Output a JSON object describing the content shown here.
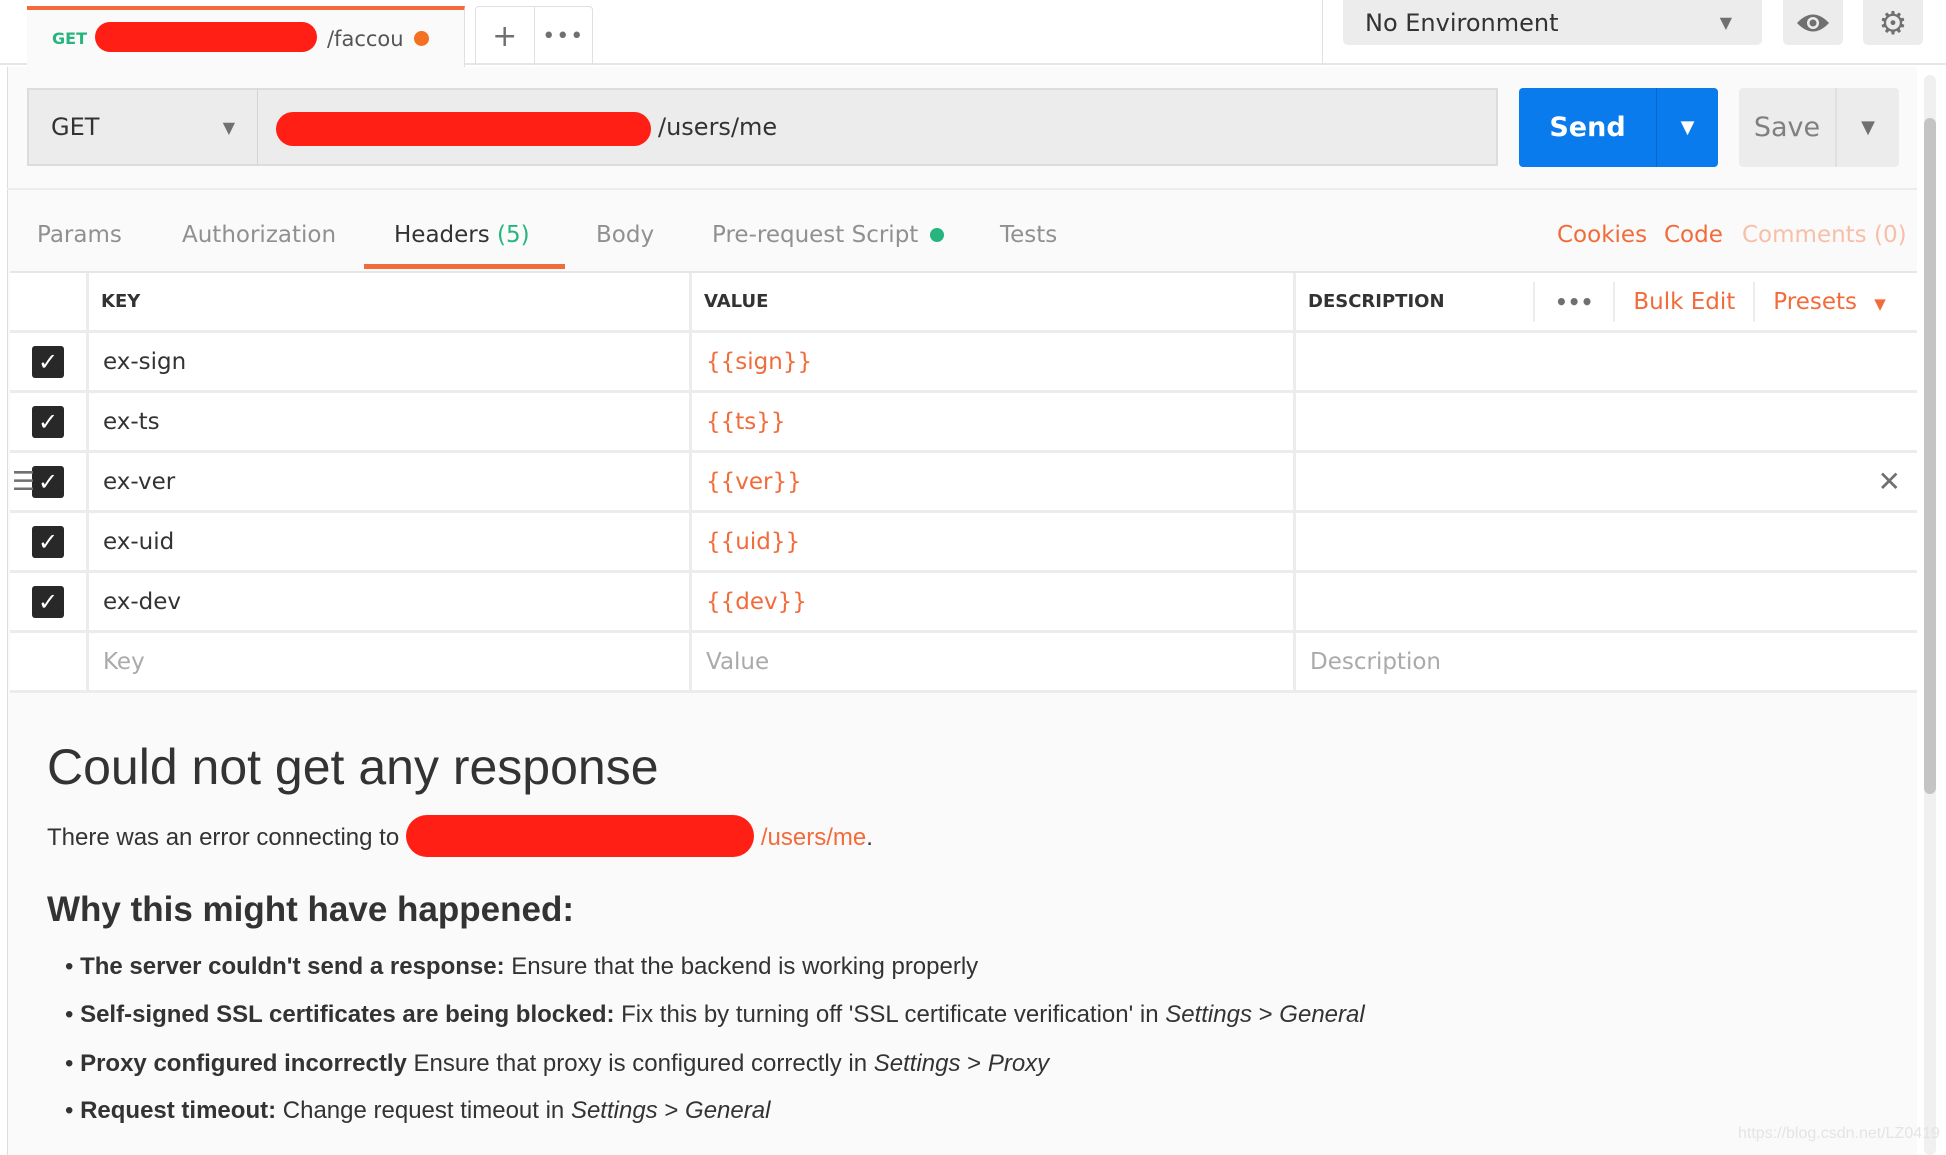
{
  "tab": {
    "method": "GET",
    "title_fragment": "/faccou",
    "unsaved_color": "#f47023"
  },
  "tab_actions": {
    "new": "+",
    "more": "•••"
  },
  "environment": {
    "selected": "No Environment"
  },
  "request": {
    "method": "GET",
    "url_fragment": "/users/me"
  },
  "buttons": {
    "send": "Send",
    "save": "Save"
  },
  "request_tabs": [
    {
      "label": "Params"
    },
    {
      "label": "Authorization"
    },
    {
      "label": "Headers",
      "count": "(5)",
      "active": true
    },
    {
      "label": "Body"
    },
    {
      "label": "Pre-request Script",
      "indicator_color": "#26b47f"
    },
    {
      "label": "Tests"
    }
  ],
  "links": {
    "cookies": "Cookies",
    "code": "Code",
    "comments": "Comments (0)"
  },
  "headers_table": {
    "columns": {
      "key": "KEY",
      "value": "VALUE",
      "description": "DESCRIPTION"
    },
    "more": "•••",
    "bulk_edit": "Bulk Edit",
    "presets": "Presets",
    "rows": [
      {
        "key": "ex-sign",
        "value": "{{sign}}",
        "checked": true
      },
      {
        "key": "ex-ts",
        "value": "{{ts}}",
        "checked": true
      },
      {
        "key": "ex-ver",
        "value": "{{ver}}",
        "checked": true
      },
      {
        "key": "ex-uid",
        "value": "{{uid}}",
        "checked": true
      },
      {
        "key": "ex-dev",
        "value": "{{dev}}",
        "checked": true
      }
    ],
    "placeholders": {
      "key": "Key",
      "value": "Value",
      "description": "Description"
    }
  },
  "response": {
    "title": "Could not get any response",
    "error_prefix": "There was an error connecting to",
    "error_url_fragment": "/users/me",
    "error_suffix": ".",
    "why_title": "Why this might have happened:",
    "reasons": [
      {
        "bold": "The server couldn't send a response:",
        "text": "Ensure that the backend is working properly"
      },
      {
        "bold": "Self-signed SSL certificates are being blocked:",
        "text": "Fix this by turning off 'SSL certificate verification' in",
        "i1": "Settings",
        "sep": ">",
        "i2": "General"
      },
      {
        "bold": "Proxy configured incorrectly",
        "text": "Ensure that proxy is configured correctly in",
        "i1": "Settings",
        "sep": ">",
        "i2": "Proxy"
      },
      {
        "bold": "Request timeout:",
        "text": "Change request timeout in",
        "i1": "Settings",
        "sep": ">",
        "i2": "General"
      }
    ]
  },
  "watermark": "https://blog.csdn.net/LZ0419",
  "colors": {
    "accent": "#f26b3a",
    "send": "#097bed",
    "method_get": "#26b47f"
  }
}
